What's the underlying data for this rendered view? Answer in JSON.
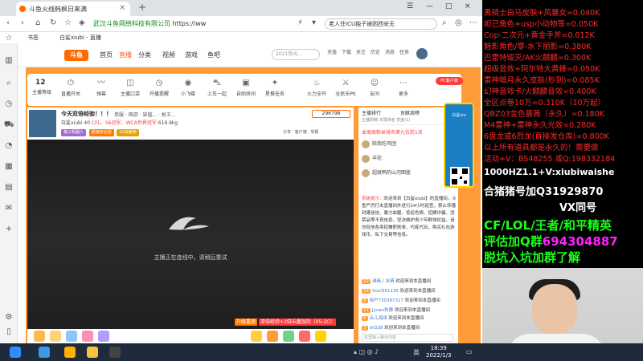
{
  "browser": {
    "tab_title": "斗鱼火线韩枫日来满",
    "url_site": "武汉斗鱼网络科技有限公司",
    "url_path": "https://ww",
    "url_extra": "老人住ICU独子被困西安无",
    "search_text": "老人住ICU独子被困西安无",
    "bookmarks_label": "书签",
    "bookmark_1": "白鲨xiubi - 直播"
  },
  "site": {
    "nav": [
      "首页",
      "直播",
      "分类",
      "视频",
      "游戏",
      "鱼吧"
    ],
    "search_placeholder": "2021我光...",
    "header_icons": [
      "充值",
      "下载",
      "关注",
      "历史",
      "消息",
      "任务"
    ]
  },
  "tools": {
    "count": "12",
    "items": [
      "主播等级",
      "直播开关",
      "弹幕",
      "主播口袋",
      "开播提醒",
      "小飞碟",
      "上车一起",
      "自助房间",
      "星推任务",
      "火力全开",
      "全民乐PK",
      "友问",
      "更多"
    ],
    "pc_badge": "PC客户端"
  },
  "room": {
    "title": "今天双倍经验！！！",
    "category": "单服 · 网游 · 穿越... · 枪王...",
    "streamer": "白鲨xiubi",
    "level": "40",
    "honor": "CFL、S6冠军、WCA世界冠军",
    "hot": "619.9kg",
    "follow": "296798",
    "tags": [
      "格斗机器人",
      "超级粉丝团",
      "10战雇佣"
    ],
    "ops": "分享 · 客户端 · 举报"
  },
  "video": {
    "offline_text": "主播正在连线中，请稍后重试",
    "footer_a": "升级重磅",
    "footer_b": "双倍经验+2倍乐趣加持（05:2C）"
  },
  "chat": {
    "tab_1": "主播排行",
    "tab_2": "贡献周榜",
    "tab_sub": "主播周榜  本周排名  赏金(1)",
    "rank_title": "本周周粉丝排名第九位前1名",
    "ranks": [
      "陪我吃鸡团",
      "羊驼",
      "超级鸭的山河图鉴"
    ],
    "sys_label": "系统提示：",
    "sys_msg": "欢迎来到【白鲨xiubi】的直播间。斗鱼严厉打击直播间外进行24小时巡查，禁止传播封建迷信、暴力血腥、低俗色情、招嫖诈骗、违禁品等不良信息，坚决维护青少年群体权益，请勿轻信各类招兼职刷单、代练代玩、购买礼包游戏币、私下交易等信息。",
    "lines": [
      {
        "lv": "22",
        "nick": "渊画丿水晴",
        "msg": "欢迎来到本直播间"
      },
      {
        "lv": "14",
        "nick": "Soul351135",
        "msg": "欢迎来到本直播间"
      },
      {
        "lv": "8",
        "nick": "用户730367317",
        "msg": "欢迎来到本直播间"
      },
      {
        "lv": "17",
        "nick": "Jyuan秋静",
        "msg": "欢迎来到本直播间"
      },
      {
        "lv": "5",
        "nick": "点儿海阔",
        "msg": "欢迎来到本直播间"
      },
      {
        "lv": "3",
        "nick": "sh338",
        "msg": "欢迎来到本直播间"
      }
    ],
    "input_placeholder": "这里输入聊天内容"
  },
  "float_ad": {
    "text": "白鲨xiu"
  },
  "overlay": {
    "red_lines": [
      "黑骑士白马皮肤+风暴女=0.040K",
      "妲己角色+usp小动物等=0.050K",
      "Cop-二次元+黄金手斧=0.012K",
      "魅影角色/零-水下丽影=0.380K",
      "巴雷特毁灭/AK火麒麟=0.300K",
      "超级音效+阿尔特大黄蜂=0.050K",
      "雷神暗月永久皮肤(秒到)=0.085K",
      "幻神音效卡/火麒麟音效=0.400K",
      "全区点卷10万=0.310K（10万起）",
      "QBZ03金色蔷薇（永久）=0.180K",
      "M4雷神+雷神永久光效=0.280K",
      "6盘龙或6烈龙(直接发仓库)=0.800K",
      "以上所有道具都是永久的！需要做",
      "活动+V：BS48255  或Q:198332184"
    ],
    "white_lines": [
      "1000HZ1.1+V:xiubiwaishe",
      "合猪猪号加Q31929870",
      "VX同号"
    ],
    "green_1": "CF/LOL/王者/和平精英",
    "green_2_a": "评估加Q群",
    "green_2_b": "694304887",
    "green_3": "脱坑入坑加群了解"
  },
  "taskbar": {
    "time": "18:39",
    "date": "2022/1/3",
    "ime": "英"
  }
}
